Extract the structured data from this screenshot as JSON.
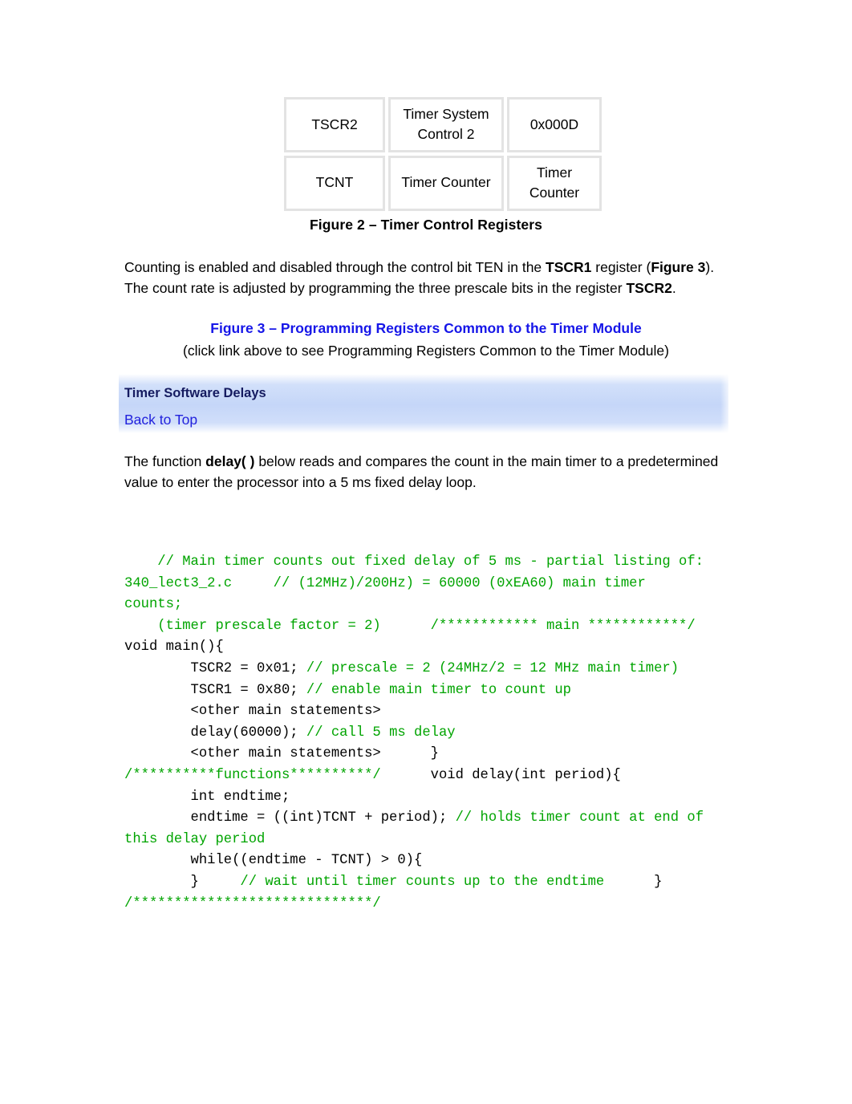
{
  "figure2": {
    "caption": "Figure 2 – Timer Control Registers",
    "table": {
      "rows": [
        {
          "name": "TSCR2",
          "description": "Timer System Control 2",
          "value": "0x000D"
        },
        {
          "name": "TCNT",
          "description": "Timer Counter",
          "value": "Timer Counter"
        }
      ]
    }
  },
  "paragraphs": {
    "counting": {
      "part1": "Counting is enabled and disabled through the control bit TEN in the ",
      "bold1": "TSCR1",
      "part2": " register (",
      "bold2": "Figure 3",
      "part3": "). The count rate is adjusted by programming the three prescale bits in the register ",
      "bold3": "TSCR2",
      "part4": "."
    },
    "delay_intro": {
      "part1": "The function ",
      "bold1": "delay( )",
      "part2": " below reads and compares the count in the main timer to a predetermined value to enter the processor into a 5 ms fixed delay loop."
    }
  },
  "figure3": {
    "link_text": "Figure 3 – Programming Registers Common to the Timer Module",
    "sub_text": "(click link above to see Programming Registers Common to the Timer Module)",
    "link_color": "#1616e8"
  },
  "section_header": {
    "title": "Timer Software Delays",
    "back_to_top": "Back to Top",
    "band_color": "#c5d6f8",
    "title_color": "#151b60",
    "link_color": "#2222dd"
  },
  "code": {
    "comment_color": "#00a400",
    "code_color": "#000000",
    "segments": [
      {
        "t": "    ",
        "c": "k"
      },
      {
        "t": "// Main timer counts out fixed delay of 5 ms - partial listing of: 340_lect3_2.c     // (12MHz)/200Hz) = 60000 (0xEA60) main timer counts;",
        "c": "g"
      },
      {
        "t": "\n    ",
        "c": "k"
      },
      {
        "t": "(timer prescale factor = 2)      /************ main ************/",
        "c": "g"
      },
      {
        "t": "      void main(){\n        TSCR2 = 0x01; ",
        "c": "k"
      },
      {
        "t": "// prescale = 2 (24MHz/2 = 12 MHz main timer)",
        "c": "g"
      },
      {
        "t": "\n        TSCR1 = 0x80; ",
        "c": "k"
      },
      {
        "t": "// enable main timer to count up",
        "c": "g"
      },
      {
        "t": "\n        <other main statements>\n        delay(60000); ",
        "c": "k"
      },
      {
        "t": "// call 5 ms delay",
        "c": "g"
      },
      {
        "t": "\n        <other main statements>      }\n",
        "c": "k"
      },
      {
        "t": "/**********functions**********/",
        "c": "g"
      },
      {
        "t": "      void delay(int period){\n        int endtime;\n        endtime = ((int)TCNT + period); ",
        "c": "k"
      },
      {
        "t": "// holds timer count at end of this delay period",
        "c": "g"
      },
      {
        "t": "\n        while((endtime - TCNT) > 0){\n        }     ",
        "c": "k"
      },
      {
        "t": "// wait until timer counts up to the endtime",
        "c": "g"
      },
      {
        "t": "      }\n",
        "c": "k"
      },
      {
        "t": "/*****************************/",
        "c": "g"
      }
    ]
  }
}
